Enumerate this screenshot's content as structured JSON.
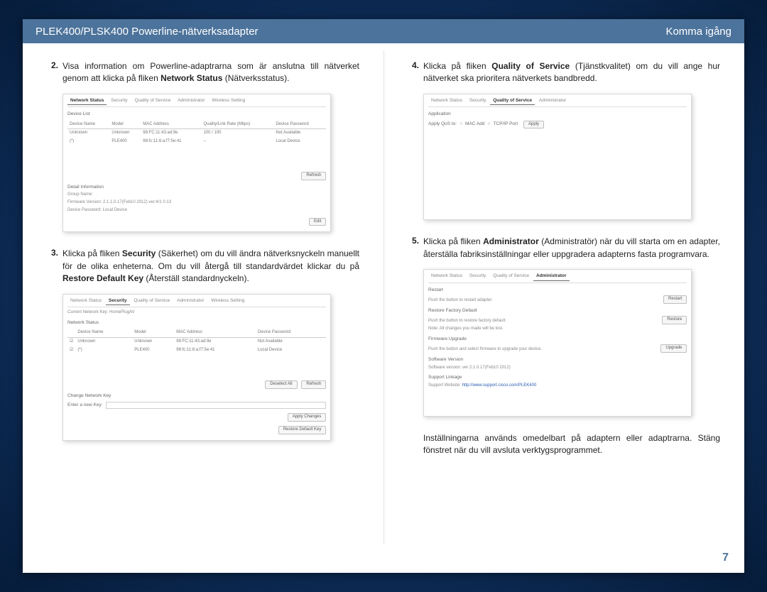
{
  "header": {
    "left": "PLEK400/PLSK400 Powerline-nätverksadapter",
    "right": "Komma igång"
  },
  "left_col": {
    "step2": {
      "num": "2.",
      "before": "Visa information om Powerline-adaptrarna som är anslutna till nätverket genom att klicka på fliken ",
      "bold": "Network Status",
      "after": " (Nätverksstatus)."
    },
    "shotA": {
      "tabs": [
        "Network Status",
        "Security",
        "Quality of Service",
        "Administrator",
        "Wireless Setting"
      ],
      "active": 0,
      "title": "Device List",
      "cols": [
        "Device Name",
        "Model",
        "MAC Address",
        "Quality/Link Rate (Mbps)",
        "Device Password"
      ],
      "rows": [
        [
          "Unknown",
          "Unknown",
          "98:FC:11:43:ad:9e",
          "100 / 100",
          "Not Available"
        ],
        [
          "(*)",
          "PLE400",
          "98:fc:11:6:a:f7:5e:41",
          "–",
          "Local Device"
        ]
      ],
      "refresh": "Refresh",
      "detail_lbl": "Detail Information",
      "group": "Group Name:",
      "fw": "Firmware Version:   2.1.1.0.17(Feb10  2012) ver:4/1 0:13",
      "pwd": "Device Password:   Local Device",
      "edit": "Edit"
    },
    "step3": {
      "num": "3.",
      "p1a": "Klicka på fliken ",
      "p1b": "Security",
      "p1c": " (Säkerhet) om du vill ändra nätverksnyckeln manuellt för de olika enheterna. Om du vill återgå till standardvärdet klickar du på ",
      "p1d": "Restore Default Key",
      "p1e": " (Återställ standardnyckeln)."
    },
    "shotB": {
      "tabs": [
        "Network Status",
        "Security",
        "Quality of Service",
        "Administrator",
        "Wireless Setting"
      ],
      "active": 1,
      "curkey": "Current Network Key:   HomePlugAV",
      "netstat": "Network Status",
      "cols": [
        "Device Name",
        "Model",
        "MAC Address",
        "Device Password"
      ],
      "rows": [
        [
          "Unknown",
          "Unknown",
          "98:FC:11:43:ad:9e",
          "Not Available"
        ],
        [
          "(*)",
          "PLE400",
          "98:fc:11:6:a:f7:5e:41",
          "Local Device"
        ]
      ],
      "desel": "Deselect All",
      "refresh": "Refresh",
      "change_lbl": "Change Network Key",
      "enter": "Enter a new Key:",
      "apply": "Apply Changes",
      "restore": "Restore Default Key"
    }
  },
  "right_col": {
    "step4": {
      "num": "4.",
      "a": "Klicka på fliken ",
      "b": "Quality of Service",
      "c": " (Tjänstkvalitet) om du vill ange hur nätverket ska prioritera nätverkets bandbredd."
    },
    "shotC": {
      "tabs": [
        "Network Status",
        "Security",
        "Quality of Service",
        "Administrator"
      ],
      "active": 2,
      "title": "Application",
      "row_lbl": "Apply QoS to:",
      "opt1": "MAC Add",
      "opt2": "TCP/IP Port",
      "btn": "Apply"
    },
    "step5": {
      "num": "5.",
      "a": "Klicka på fliken ",
      "b": "Administrator",
      "c": " (Administratör) när du vill starta om en adapter, återställa fabriksinställningar eller uppgradera adapterns fasta programvara."
    },
    "shotD": {
      "tabs": [
        "Network Status",
        "Security",
        "Quality of Service",
        "Administrator"
      ],
      "active": 3,
      "s_restart": "Restart",
      "r1": "Push the button to restart adapter.",
      "b1": "Restart",
      "s_rfd": "Restore Factory Default",
      "r2a": "Push the button to restore factory default.",
      "r2b": "Note: All changes you made will be lost.",
      "b2": "Restore",
      "s_fw": "Firmware Upgrade",
      "r3": "Push the button and select firmware to upgrade your device.",
      "b3": "Upgrade",
      "s_sw": "Software Version",
      "swv": "Software version:   ver 2.1.0.17(Feb10  2012)",
      "s_link": "Support Linkage",
      "linklbl": "Support Website:",
      "link": "http://www.support.cisco.com/PLEK400"
    },
    "closing": "Inställningarna används omedelbart på adaptern eller adaptrarna. Stäng fönstret när du vill avsluta verktygsprogrammet."
  },
  "page_number": "7"
}
